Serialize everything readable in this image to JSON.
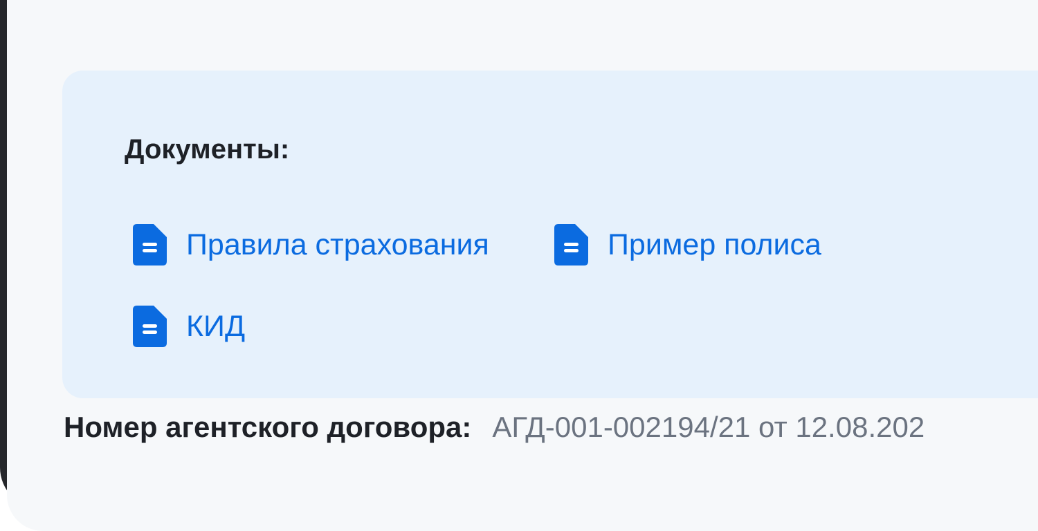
{
  "documents": {
    "title": "Документы:",
    "links": [
      {
        "label": "Правила страхования",
        "icon": "document-icon"
      },
      {
        "label": "Пример полиса",
        "icon": "document-icon"
      },
      {
        "label": "КИД",
        "icon": "document-icon"
      }
    ],
    "accent_color": "#0b6be0",
    "card_background": "#e6f1fc"
  },
  "contract": {
    "label": "Номер агентского договора:",
    "value": "АГД-001-002194/21 от 12.08.202"
  }
}
